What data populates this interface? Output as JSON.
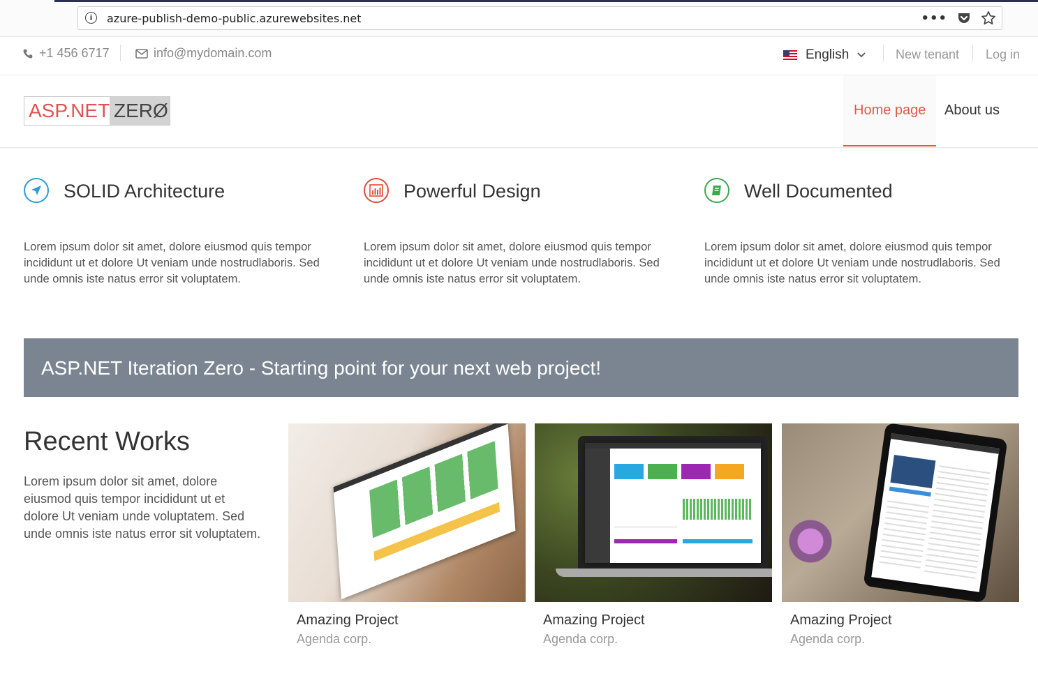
{
  "browser": {
    "url": "azure-publish-demo-public.azurewebsites.net"
  },
  "topbar": {
    "phone": "+1 456 6717",
    "email": "info@mydomain.com",
    "language": "English",
    "new_tenant": "New tenant",
    "login": "Log in"
  },
  "header": {
    "logo": {
      "part1": "ASP.NET",
      "part2": "ZERØ"
    },
    "nav": [
      {
        "label": "Home page"
      },
      {
        "label": "About us"
      }
    ]
  },
  "features": [
    {
      "title": "SOLID Architecture",
      "icon": "location-arrow-icon",
      "color": "#2d9ad6",
      "text": "Lorem ipsum dolor sit amet, dolore eiusmod quis tempor incididunt ut et dolore Ut veniam unde nostrudlaboris. Sed unde omnis iste natus error sit voluptatem."
    },
    {
      "title": "Powerful Design",
      "icon": "bar-chart-icon",
      "color": "#e04a3a",
      "text": "Lorem ipsum dolor sit amet, dolore eiusmod quis tempor incididunt ut et dolore Ut veniam unde nostrudlaboris. Sed unde omnis iste natus error sit voluptatem."
    },
    {
      "title": "Well Documented",
      "icon": "book-icon",
      "color": "#3aaa4a",
      "text": "Lorem ipsum dolor sit amet, dolore eiusmod quis tempor incididunt ut et dolore Ut veniam unde nostrudlaboris. Sed unde omnis iste natus error sit voluptatem."
    }
  ],
  "banner": {
    "text": "ASP.NET Iteration Zero - Starting point for your next web project!"
  },
  "recent_works": {
    "title": "Recent Works",
    "text": "Lorem ipsum dolor sit amet, dolore eiusmod quis tempor incididunt ut et dolore Ut veniam unde voluptatem. Sed unde omnis iste natus error sit voluptatem.",
    "projects": [
      {
        "title": "Amazing Project",
        "company": "Agenda corp."
      },
      {
        "title": "Amazing Project",
        "company": "Agenda corp."
      },
      {
        "title": "Amazing Project",
        "company": "Agenda corp."
      }
    ]
  }
}
